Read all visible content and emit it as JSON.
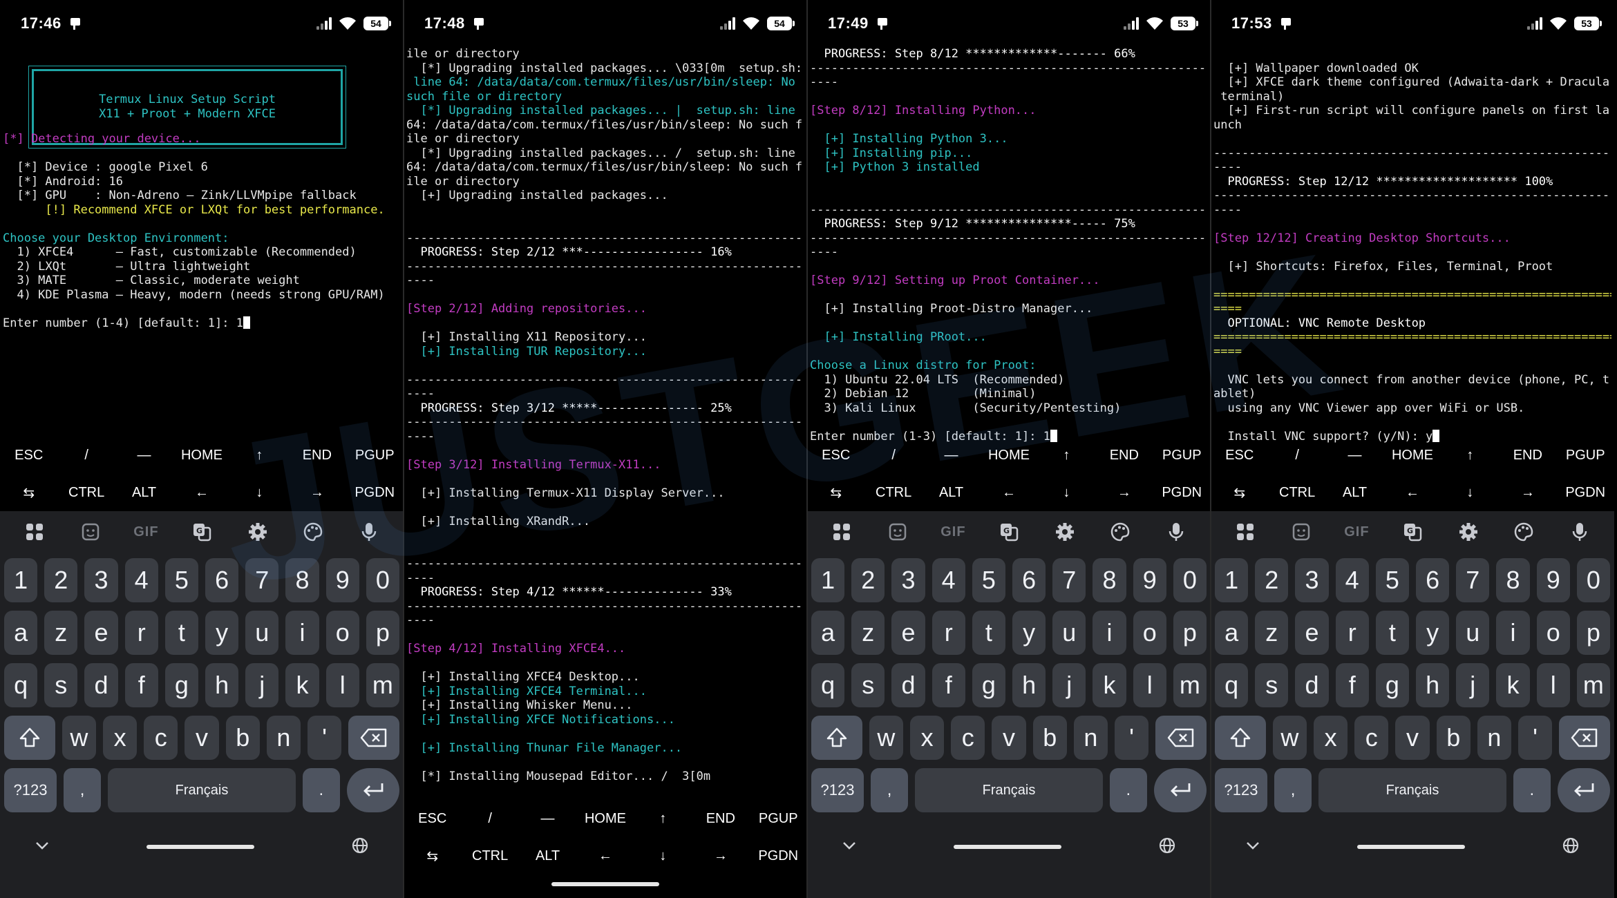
{
  "watermark": {
    "part1": "JUST",
    "part2": "GEEK"
  },
  "extra_keys": {
    "row1": [
      "ESC",
      "/",
      "—",
      "HOME",
      "↑",
      "END",
      "PGUP"
    ],
    "row2": [
      "⇆",
      "CTRL",
      "ALT",
      "←",
      "↓",
      "→",
      "PGDN"
    ]
  },
  "keyboard": {
    "numbers": [
      "1",
      "2",
      "3",
      "4",
      "5",
      "6",
      "7",
      "8",
      "9",
      "0"
    ],
    "row1": [
      "a",
      "z",
      "e",
      "r",
      "t",
      "y",
      "u",
      "i",
      "o",
      "p"
    ],
    "row2": [
      "q",
      "s",
      "d",
      "f",
      "g",
      "h",
      "j",
      "k",
      "l",
      "m"
    ],
    "row3": [
      "w",
      "x",
      "c",
      "v",
      "b",
      "n",
      "'"
    ],
    "sym_label": "?123",
    "comma": ",",
    "space_label": "Français",
    "period": "."
  },
  "screens": [
    {
      "time": "17:46",
      "battery": "54",
      "banner": [
        "Termux Linux Setup Script",
        "X11 + Proot + Modern XFCE"
      ],
      "lines": [
        {
          "t": "",
          "c": ""
        },
        {
          "t": "",
          "c": ""
        },
        {
          "t": "",
          "c": ""
        },
        {
          "t": "",
          "c": ""
        },
        {
          "t": "",
          "c": ""
        },
        {
          "t": "",
          "c": ""
        },
        {
          "t": "[*] Detecting your device...",
          "c": "c-magenta"
        },
        {
          "t": "",
          "c": ""
        },
        {
          "t": "  [*] Device : google Pixel 6",
          "c": ""
        },
        {
          "t": "  [*] Android: 16",
          "c": ""
        },
        {
          "t": "  [*] GPU    : Non-Adreno — Zink/LLVMpipe fallback",
          "c": ""
        },
        {
          "t": "      [!] Recommend XFCE or LXQt for best performance.",
          "c": "c-yellow"
        },
        {
          "t": "",
          "c": ""
        },
        {
          "t": "Choose your Desktop Environment:",
          "c": "c-cyan"
        },
        {
          "t": "  1) XFCE4      — Fast, customizable (Recommended)",
          "c": ""
        },
        {
          "t": "  2) LXQt       — Ultra lightweight",
          "c": ""
        },
        {
          "t": "  3) MATE       — Classic, moderate weight",
          "c": ""
        },
        {
          "t": "  4) KDE Plasma — Heavy, modern (needs strong GPU/RAM)",
          "c": ""
        },
        {
          "t": "",
          "c": ""
        },
        {
          "t": "Enter number (1-4) [default: 1]: 1",
          "c": "",
          "cursor": true
        }
      ]
    },
    {
      "time": "17:48",
      "battery": "54",
      "lines": [
        {
          "t": "ile or directory",
          "c": ""
        },
        {
          "t": "  [*] Upgrading installed packages... \\033[0m  setup.sh:",
          "c": ""
        },
        {
          "t": " line 64: /data/data/com.termux/files/usr/bin/sleep: No",
          "c": "c-cyan"
        },
        {
          "t": "such file or directory",
          "c": "c-cyan"
        },
        {
          "t": "  [*] Upgrading installed packages... |  setup.sh: line",
          "c": "c-cyan"
        },
        {
          "t": "64: /data/data/com.termux/files/usr/bin/sleep: No such f",
          "c": ""
        },
        {
          "t": "ile or directory",
          "c": ""
        },
        {
          "t": "  [*] Upgrading installed packages... /  setup.sh: line",
          "c": ""
        },
        {
          "t": "64: /data/data/com.termux/files/usr/bin/sleep: No such f",
          "c": ""
        },
        {
          "t": "ile or directory",
          "c": ""
        },
        {
          "t": "  [+] Upgrading installed packages...",
          "c": ""
        },
        {
          "t": "",
          "c": ""
        },
        {
          "t": "",
          "c": ""
        },
        {
          "t": "---------------------------------------------------------",
          "c": ""
        },
        {
          "t": "  PROGRESS: Step 2/12 ***----------------- 16%",
          "c": "c-white"
        },
        {
          "t": "---------------------------------------------------------",
          "c": ""
        },
        {
          "t": "----",
          "c": ""
        },
        {
          "t": "",
          "c": ""
        },
        {
          "t": "[Step 2/12] Adding repositories...",
          "c": "c-magenta"
        },
        {
          "t": "",
          "c": ""
        },
        {
          "t": "  [+] Installing X11 Repository...",
          "c": ""
        },
        {
          "t": "  [+] Installing TUR Repository...",
          "c": "c-cyan"
        },
        {
          "t": "",
          "c": ""
        },
        {
          "t": "---------------------------------------------------------",
          "c": ""
        },
        {
          "t": "----",
          "c": ""
        },
        {
          "t": "  PROGRESS: Step 3/12 *****--------------- 25%",
          "c": "c-white"
        },
        {
          "t": "---------------------------------------------------------",
          "c": ""
        },
        {
          "t": "----",
          "c": ""
        },
        {
          "t": "",
          "c": ""
        },
        {
          "t": "[Step 3/12] Installing Termux-X11...",
          "c": "c-magenta"
        },
        {
          "t": "",
          "c": ""
        },
        {
          "t": "  [+] Installing Termux-X11 Display Server...",
          "c": ""
        },
        {
          "t": "",
          "c": ""
        },
        {
          "t": "  [+] Installing XRandR...",
          "c": ""
        },
        {
          "t": "",
          "c": ""
        },
        {
          "t": "",
          "c": ""
        },
        {
          "t": "---------------------------------------------------------",
          "c": ""
        },
        {
          "t": "----",
          "c": ""
        },
        {
          "t": "  PROGRESS: Step 4/12 ******-------------- 33%",
          "c": "c-white"
        },
        {
          "t": "---------------------------------------------------------",
          "c": ""
        },
        {
          "t": "----",
          "c": ""
        },
        {
          "t": "",
          "c": ""
        },
        {
          "t": "[Step 4/12] Installing XFCE4...",
          "c": "c-magenta"
        },
        {
          "t": "",
          "c": ""
        },
        {
          "t": "  [+] Installing XFCE4 Desktop...",
          "c": ""
        },
        {
          "t": "  [+] Installing XFCE4 Terminal...",
          "c": "c-cyan"
        },
        {
          "t": "  [+] Installing Whisker Menu...",
          "c": ""
        },
        {
          "t": "  [+] Installing XFCE Notifications...",
          "c": "c-cyan"
        },
        {
          "t": "",
          "c": ""
        },
        {
          "t": "  [+] Installing Thunar File Manager...",
          "c": "c-cyan"
        },
        {
          "t": "",
          "c": ""
        },
        {
          "t": "  [*] Installing Mousepad Editor... /  3[0m",
          "c": ""
        }
      ]
    },
    {
      "time": "17:49",
      "battery": "53",
      "lines": [
        {
          "t": "  PROGRESS: Step 8/12 *************------- 66%",
          "c": "c-white"
        },
        {
          "t": "---------------------------------------------------------",
          "c": ""
        },
        {
          "t": "----",
          "c": ""
        },
        {
          "t": "",
          "c": ""
        },
        {
          "t": "[Step 8/12] Installing Python...",
          "c": "c-magenta"
        },
        {
          "t": "",
          "c": ""
        },
        {
          "t": "  [+] Installing Python 3...",
          "c": "c-cyan"
        },
        {
          "t": "  [+] Installing pip...",
          "c": "c-cyan"
        },
        {
          "t": "  [+] Python 3 installed",
          "c": "c-cyan"
        },
        {
          "t": "",
          "c": ""
        },
        {
          "t": "",
          "c": ""
        },
        {
          "t": "---------------------------------------------------------",
          "c": ""
        },
        {
          "t": "  PROGRESS: Step 9/12 ***************----- 75%",
          "c": "c-white"
        },
        {
          "t": "---------------------------------------------------------",
          "c": ""
        },
        {
          "t": "----",
          "c": ""
        },
        {
          "t": "",
          "c": ""
        },
        {
          "t": "[Step 9/12] Setting up Proot Container...",
          "c": "c-magenta"
        },
        {
          "t": "",
          "c": ""
        },
        {
          "t": "  [+] Installing Proot-Distro Manager...",
          "c": ""
        },
        {
          "t": "",
          "c": ""
        },
        {
          "t": "  [+] Installing PRoot...",
          "c": "c-cyan"
        },
        {
          "t": "",
          "c": ""
        },
        {
          "t": "Choose a Linux distro for Proot:",
          "c": "c-cyan"
        },
        {
          "t": "  1) Ubuntu 22.04 LTS  (Recommended)",
          "c": ""
        },
        {
          "t": "  2) Debian 12         (Minimal)",
          "c": ""
        },
        {
          "t": "  3) Kali Linux        (Security/Pentesting)",
          "c": ""
        },
        {
          "t": "",
          "c": ""
        },
        {
          "t": "Enter number (1-3) [default: 1]: 1",
          "c": "",
          "cursor": true
        }
      ]
    },
    {
      "time": "17:53",
      "battery": "53",
      "lines": [
        {
          "t": "",
          "c": ""
        },
        {
          "t": "  [+] Wallpaper downloaded OK",
          "c": ""
        },
        {
          "t": "  [+] XFCE dark theme configured (Adwaita-dark + Dracula",
          "c": ""
        },
        {
          "t": " terminal)",
          "c": ""
        },
        {
          "t": "  [+] First-run script will configure panels on first la",
          "c": ""
        },
        {
          "t": "unch",
          "c": ""
        },
        {
          "t": "",
          "c": ""
        },
        {
          "t": "---------------------------------------------------------",
          "c": ""
        },
        {
          "t": "----",
          "c": ""
        },
        {
          "t": "  PROGRESS: Step 12/12 ******************** 100%",
          "c": "c-white"
        },
        {
          "t": "---------------------------------------------------------",
          "c": ""
        },
        {
          "t": "----",
          "c": ""
        },
        {
          "t": "",
          "c": ""
        },
        {
          "t": "[Step 12/12] Creating Desktop Shortcuts...",
          "c": "c-magenta"
        },
        {
          "t": "",
          "c": ""
        },
        {
          "t": "  [+] Shortcuts: Firefox, Files, Terminal, Proot",
          "c": ""
        },
        {
          "t": "",
          "c": ""
        },
        {
          "t": "=========================================================",
          "c": "c-yellow"
        },
        {
          "t": "====",
          "c": "c-yellow"
        },
        {
          "t": "  OPTIONAL: VNC Remote Desktop",
          "c": "c-white"
        },
        {
          "t": "=========================================================",
          "c": "c-yellow"
        },
        {
          "t": "====",
          "c": "c-yellow"
        },
        {
          "t": "",
          "c": ""
        },
        {
          "t": "  VNC lets you connect from another device (phone, PC, t",
          "c": ""
        },
        {
          "t": "ablet)",
          "c": ""
        },
        {
          "t": "  using any VNC Viewer app over WiFi or USB.",
          "c": ""
        },
        {
          "t": "",
          "c": ""
        },
        {
          "t": "  Install VNC support? (y/N): y",
          "c": "",
          "cursor": true
        }
      ]
    }
  ]
}
